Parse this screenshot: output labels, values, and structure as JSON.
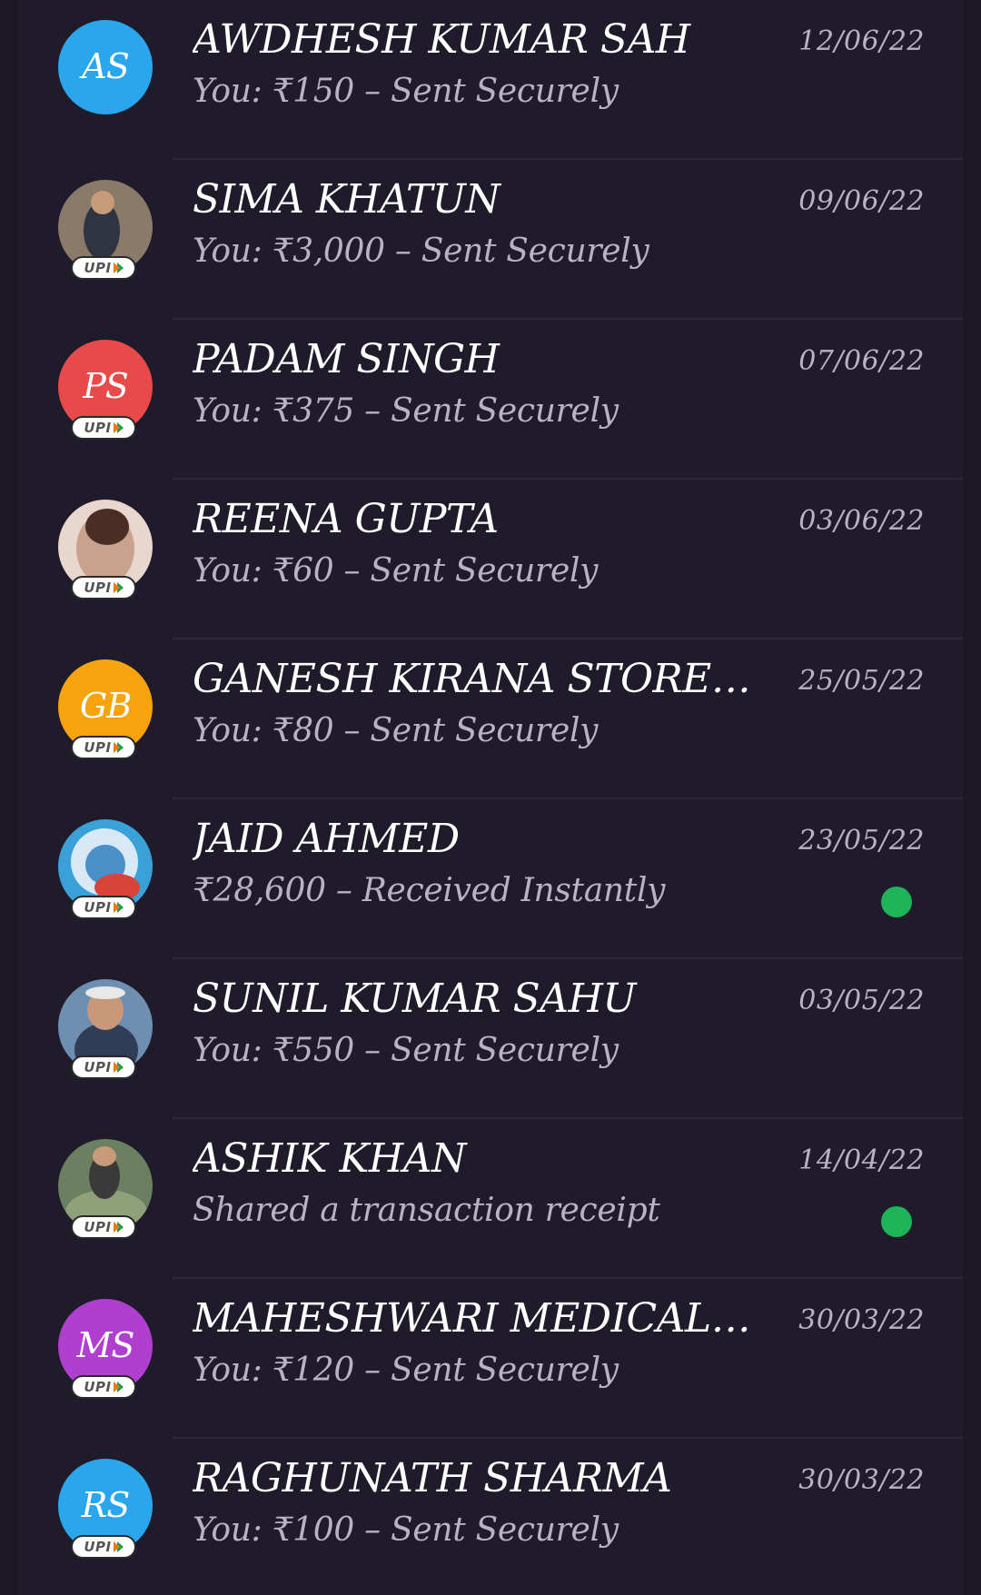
{
  "colors": {
    "background": "#1b1723",
    "panel": "#201b2b",
    "unread": "#1fb45a",
    "upi_orange": "#e87b1c",
    "upi_green": "#1f9d4b"
  },
  "upi_badge_label": "UPI",
  "contacts": [
    {
      "name": "AWDHESH KUMAR SAH",
      "subtitle": "You: ₹150 – Sent Securely",
      "date": "12/06/22",
      "initials": "AS",
      "avatar_type": "initials",
      "avatar_color": "#2aa7ec",
      "upi": false,
      "unread": false
    },
    {
      "name": "SIMA  KHATUN",
      "subtitle": "You: ₹3,000 – Sent Securely",
      "date": "09/06/22",
      "initials": "",
      "avatar_type": "photo",
      "avatar_color": "#8a7a6a",
      "upi": true,
      "unread": false
    },
    {
      "name": "PADAM SINGH",
      "subtitle": "You: ₹375 – Sent Securely",
      "date": "07/06/22",
      "initials": "PS",
      "avatar_type": "initials",
      "avatar_color": "#e84a4a",
      "upi": true,
      "unread": false
    },
    {
      "name": "REENA GUPTA",
      "subtitle": "You: ₹60 – Sent Securely",
      "date": "03/06/22",
      "initials": "",
      "avatar_type": "photo",
      "avatar_color": "#e8d6cf",
      "upi": true,
      "unread": false
    },
    {
      "name": "GANESH KIRANA STORE BIJ...",
      "subtitle": "You: ₹80 – Sent Securely",
      "date": "25/05/22",
      "initials": "GB",
      "avatar_type": "initials",
      "avatar_color": "#f7a30e",
      "upi": true,
      "unread": false
    },
    {
      "name": "JAID AHMED",
      "subtitle": "₹28,600 – Received Instantly",
      "date": "23/05/22",
      "initials": "",
      "avatar_type": "photo",
      "avatar_color": "#3aa0d8",
      "upi": true,
      "unread": true
    },
    {
      "name": "SUNIL KUMAR SAHU",
      "subtitle": "You: ₹550 – Sent Securely",
      "date": "03/05/22",
      "initials": "",
      "avatar_type": "photo",
      "avatar_color": "#6f8fb0",
      "upi": true,
      "unread": false
    },
    {
      "name": "ASHIK  KHAN",
      "subtitle": "Shared a transaction receipt",
      "date": "14/04/22",
      "initials": "",
      "avatar_type": "photo",
      "avatar_color": "#6a8060",
      "upi": true,
      "unread": true
    },
    {
      "name": "MAHESHWARI MEDICAL STO...",
      "subtitle": "You: ₹120 – Sent Securely",
      "date": "30/03/22",
      "initials": "MS",
      "avatar_type": "initials",
      "avatar_color": "#b03fd0",
      "upi": true,
      "unread": false
    },
    {
      "name": "RAGHUNATH SHARMA",
      "subtitle": "You: ₹100 – Sent Securely",
      "date": "30/03/22",
      "initials": "RS",
      "avatar_type": "initials",
      "avatar_color": "#2aa7ec",
      "upi": true,
      "unread": false
    }
  ]
}
